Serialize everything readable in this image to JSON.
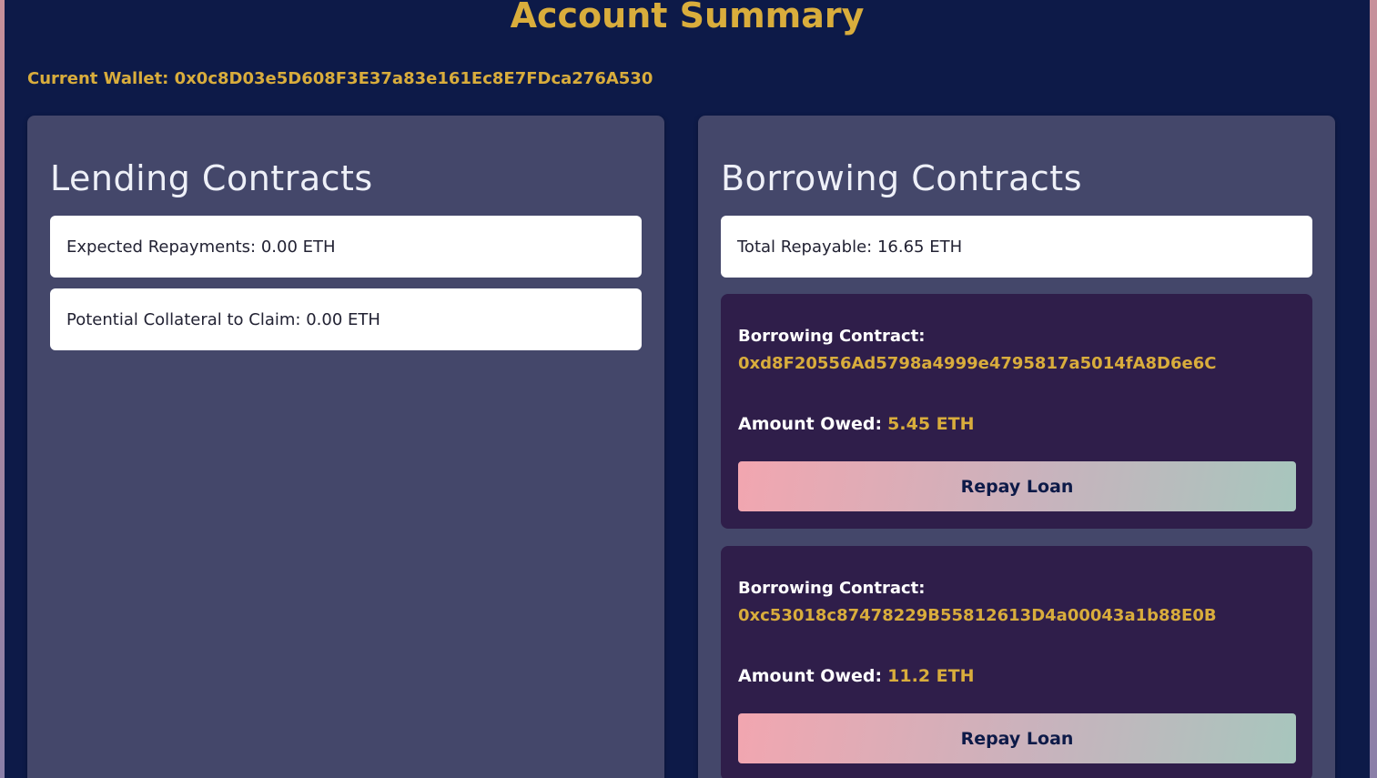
{
  "header": {
    "title": "Account Summary",
    "wallet_label": "Current Wallet:",
    "wallet_address": "0x0c8D03e5D608F3E37a83e161Ec8E7FDca276A530"
  },
  "lending": {
    "heading": "Lending Contracts",
    "expected_repayments": "Expected Repayments: 0.00 ETH",
    "potential_collateral": "Potential Collateral to Claim: 0.00 ETH"
  },
  "borrowing": {
    "heading": "Borrowing Contracts",
    "total_repayable": "Total Repayable: 16.65 ETH",
    "contracts": [
      {
        "title": "Borrowing Contract:",
        "address": "0xd8F20556Ad5798a4999e4795817a5014fA8D6e6C",
        "owed_label": "Amount Owed:",
        "owed_value": "5.45 ETH",
        "button_label": "Repay Loan"
      },
      {
        "title": "Borrowing Contract:",
        "address": "0xc53018c87478229B55812613D4a00043a1b88E0B",
        "owed_label": "Amount Owed:",
        "owed_value": "11.2 ETH",
        "button_label": "Repay Loan"
      }
    ]
  },
  "colors": {
    "background": "#0d1a48",
    "panel": "#44476a",
    "loan_card": "#2f1e4a",
    "accent_gold": "#d9ad3c",
    "button_gradient_start": "#f2a6b0",
    "button_gradient_end": "#a7c6bd"
  }
}
